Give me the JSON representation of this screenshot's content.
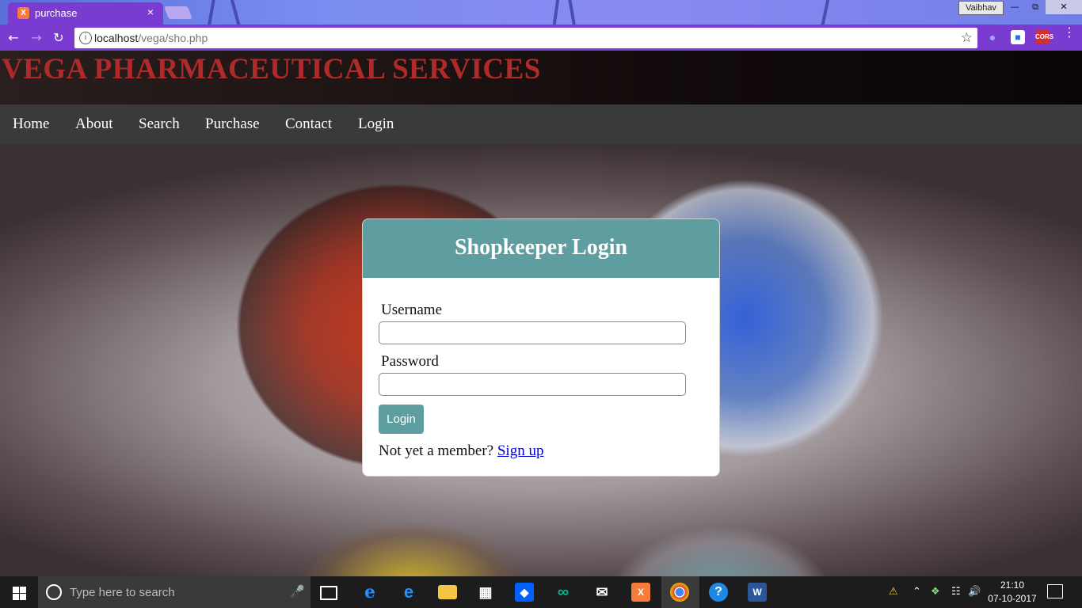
{
  "browser": {
    "tab_title": "purchase",
    "tab_close": "×",
    "profile_name": "Vaibhav",
    "url_host": "localhost",
    "url_path": "/vega/sho.php",
    "ext_cors": "CORS"
  },
  "site": {
    "brand": "VEGA PHARMACEUTICAL SERVICES",
    "nav": [
      "Home",
      "About",
      "Search",
      "Purchase",
      "Contact",
      "Login"
    ]
  },
  "login": {
    "title": "Shopkeeper Login",
    "username_label": "Username",
    "username_value": "",
    "password_label": "Password",
    "password_value": "",
    "button": "Login",
    "member_text": "Not yet a member?",
    "signup_link": "Sign up"
  },
  "taskbar": {
    "search_placeholder": "Type here to search",
    "time": "21:10",
    "date": "07-10-2017"
  },
  "colors": {
    "accent": "#5f9ea0",
    "brand": "#b02a2a",
    "navbar": "#3a3a3a",
    "chrome": "#7a3bd0"
  }
}
